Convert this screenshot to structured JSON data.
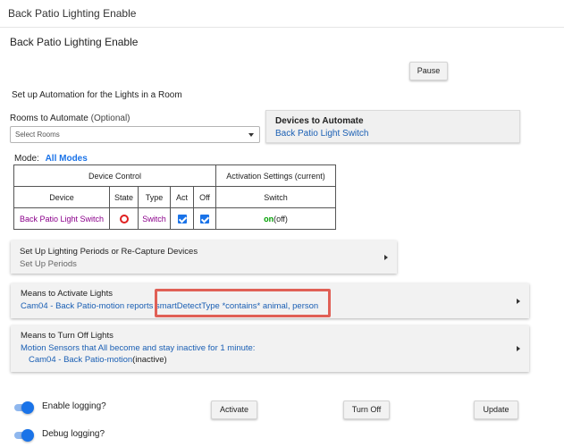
{
  "app": {
    "title": "Back Patio Lighting Enable"
  },
  "page": {
    "title": "Back Patio Lighting Enable"
  },
  "pause_label": "Pause",
  "setup": {
    "title": "Set up Automation for the Lights in a Room",
    "rooms_label": "Rooms to Automate",
    "rooms_optional": "(Optional)",
    "rooms_value": "Select Rooms"
  },
  "devices_card": {
    "title": "Devices to Automate",
    "value": "Back Patio Light Switch"
  },
  "mode": {
    "label": "Mode:",
    "value": "All Modes"
  },
  "table": {
    "group_device_control": "Device Control",
    "group_activation": "Activation Settings (current)",
    "headers": {
      "device": "Device",
      "state": "State",
      "type": "Type",
      "act": "Act",
      "off": "Off",
      "switch": "Switch"
    },
    "row": {
      "device": "Back Patio Light Switch",
      "type": "Switch",
      "switch_on": "on",
      "switch_rest": "(off)"
    }
  },
  "cards": {
    "periods": {
      "title": "Set Up Lighting Periods or Re-Capture Devices",
      "subtitle": "Set Up Periods"
    },
    "activate": {
      "title": "Means to Activate Lights",
      "subtitle": "Cam04 - Back Patio-motion reports smartDetectType *contains* animal, person"
    },
    "turnoff": {
      "title": "Means to Turn Off Lights",
      "line1": "Motion Sensors that All become and stay inactive for 1 minute:",
      "line2_device": "Cam04 - Back Patio-motion",
      "line2_state": "(inactive)"
    }
  },
  "toggles": {
    "enable_logging": "Enable logging?",
    "debug_logging": "Debug logging?"
  },
  "buttons": {
    "activate": "Activate",
    "turn_off": "Turn Off",
    "update": "Update"
  },
  "colors": {
    "accent": "#1a73e8",
    "highlight": "#e06056",
    "device_purple": "#8b008b",
    "on_green": "#00a000"
  }
}
